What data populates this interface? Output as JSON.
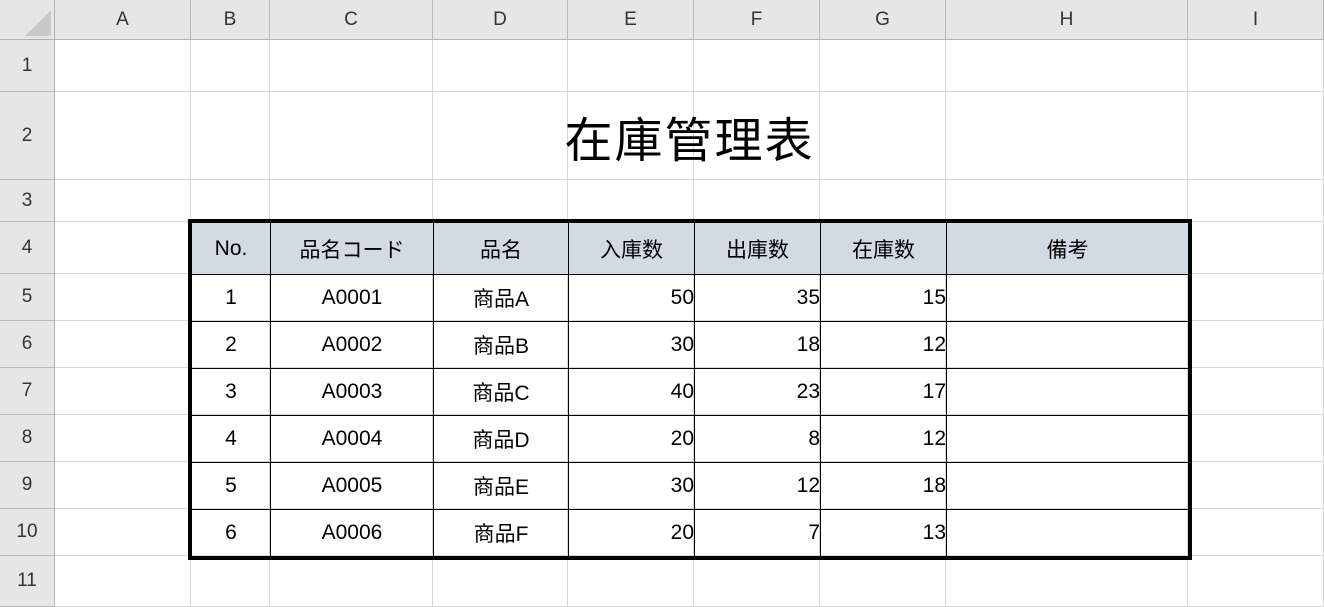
{
  "spreadsheet": {
    "corner_label": "select-all",
    "columns": [
      "A",
      "B",
      "C",
      "D",
      "E",
      "F",
      "G",
      "H",
      "I"
    ],
    "rows": [
      "1",
      "2",
      "3",
      "4",
      "5",
      "6",
      "7",
      "8",
      "9",
      "10",
      "11"
    ],
    "header_bg": "#e6e6e6",
    "gridline_color": "#d7d7d7"
  },
  "document": {
    "title": "在庫管理表"
  },
  "table": {
    "header_bg": "#d2dae4",
    "border_color": "#000000",
    "headers": [
      "No.",
      "品名コード",
      "品名",
      "入庫数",
      "出庫数",
      "在庫数",
      "備考"
    ],
    "rows": [
      {
        "no": "1",
        "code": "A0001",
        "name": "商品A",
        "in": "50",
        "out": "35",
        "stock": "15",
        "note": ""
      },
      {
        "no": "2",
        "code": "A0002",
        "name": "商品B",
        "in": "30",
        "out": "18",
        "stock": "12",
        "note": ""
      },
      {
        "no": "3",
        "code": "A0003",
        "name": "商品C",
        "in": "40",
        "out": "23",
        "stock": "17",
        "note": ""
      },
      {
        "no": "4",
        "code": "A0004",
        "name": "商品D",
        "in": "20",
        "out": "8",
        "stock": "12",
        "note": ""
      },
      {
        "no": "5",
        "code": "A0005",
        "name": "商品E",
        "in": "30",
        "out": "12",
        "stock": "18",
        "note": ""
      },
      {
        "no": "6",
        "code": "A0006",
        "name": "商品F",
        "in": "20",
        "out": "7",
        "stock": "13",
        "note": ""
      }
    ]
  }
}
